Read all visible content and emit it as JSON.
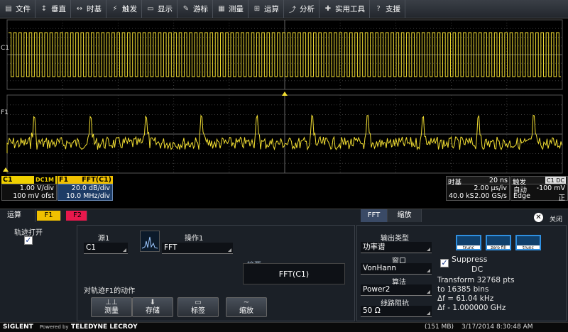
{
  "menubar": {
    "items": [
      {
        "icon": "▤",
        "label": "文件"
      },
      {
        "icon": "↕",
        "label": "垂直"
      },
      {
        "icon": "↔",
        "label": "时基"
      },
      {
        "icon": "⚡",
        "label": "触发"
      },
      {
        "icon": "▭",
        "label": "显示"
      },
      {
        "icon": "✎",
        "label": "游标"
      },
      {
        "icon": "▦",
        "label": "测量"
      },
      {
        "icon": "⊞",
        "label": "运算"
      },
      {
        "icon": "⤴",
        "label": "分析"
      },
      {
        "icon": "✚",
        "label": "实用工具"
      },
      {
        "icon": "?",
        "label": "支援"
      }
    ]
  },
  "screen": {
    "c1_label": "C1",
    "f1_label": "F1"
  },
  "colors": {
    "trace": "#f2de32",
    "grid": "#3c3c3c",
    "f1_accent": "#f0c000",
    "f2_accent": "#e8184c"
  },
  "c1_descriptor": {
    "name": "C1",
    "coupling": "DC1M",
    "vdiv": "1.00 V/div",
    "offset": "100 mV ofst"
  },
  "f1_descriptor": {
    "name": "F1",
    "op": "FFT(C1)",
    "vdiv": "20.0 dB/div",
    "hdiv": "10.0 MHz/div"
  },
  "timebase": {
    "label": "时基",
    "time_per_div": "20 ns",
    "sub_rate": "2.00 µs/iv",
    "points": "40.0 kS",
    "rate": "2.00 GS/s"
  },
  "trigger": {
    "label": "触发",
    "badge": "C1 DC",
    "mode": "自动",
    "level": "-100 mV",
    "type": "Edge",
    "slope": "正"
  },
  "dialog": {
    "tabs": {
      "math": "运算",
      "f1": "F1",
      "f2": "F2",
      "fft": "FFT",
      "zoom": "缩放"
    },
    "close_label": "关闭",
    "trace_on_label": "轨迹打开",
    "source_label": "源1",
    "source_value": "C1",
    "operator_label": "操作1",
    "operator_value": "FFT",
    "summary_label": "摘要",
    "summary_value": "FFT(C1)",
    "actions_label": "对轨迹F1的动作",
    "buttons": [
      {
        "icon": "⊥⊥",
        "label": "测量"
      },
      {
        "icon": "⬇",
        "label": "存储"
      },
      {
        "icon": "▭",
        "label": "标签"
      },
      {
        "icon": "~",
        "label": "缩放"
      }
    ],
    "output_type_label": "输出类型",
    "output_type_value": "功率谱",
    "window_label": "窗口",
    "window_value": "VonHann",
    "algorithm_label": "算法",
    "algorithm_value": "Power2",
    "impedance_label": "线路阻抗",
    "impedance_value": "50 Ω",
    "suppress_label": "Suppress",
    "suppress_dc": "DC",
    "window_buttons": [
      "trunc",
      "zero fill",
      "trunc"
    ],
    "info": {
      "line1": "Transform 32768 pts",
      "line2": "to 16385 bins",
      "line3": "Δf = 61.04 kHz",
      "line4": "Δf - 1.000000 GHz"
    }
  },
  "statusbar": {
    "brand": "SIGLENT",
    "powered": "Powered by",
    "brand2": "TELEDYNE LECROY",
    "memory": "(151 MB)",
    "datetime": "3/17/2014 8:30:48 AM"
  }
}
